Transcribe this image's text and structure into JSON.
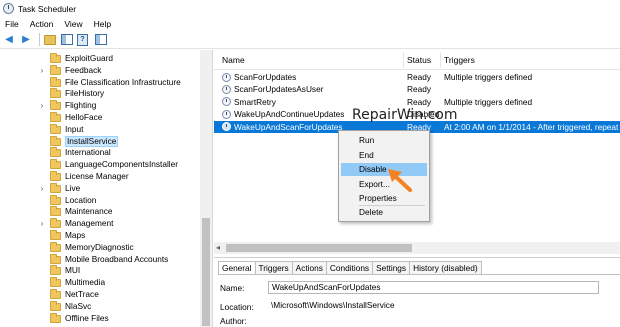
{
  "window": {
    "title": "Task Scheduler"
  },
  "menubar": [
    "File",
    "Action",
    "View",
    "Help"
  ],
  "tree": {
    "items": [
      {
        "label": "ExploitGuard",
        "expandable": false
      },
      {
        "label": "Feedback",
        "expandable": true
      },
      {
        "label": "File Classification Infrastructure",
        "expandable": false
      },
      {
        "label": "FileHistory",
        "expandable": false
      },
      {
        "label": "Flighting",
        "expandable": true
      },
      {
        "label": "HelloFace",
        "expandable": false
      },
      {
        "label": "Input",
        "expandable": false
      },
      {
        "label": "InstallService",
        "expandable": false,
        "selected": true
      },
      {
        "label": "International",
        "expandable": false
      },
      {
        "label": "LanguageComponentsInstaller",
        "expandable": false
      },
      {
        "label": "License Manager",
        "expandable": false
      },
      {
        "label": "Live",
        "expandable": true
      },
      {
        "label": "Location",
        "expandable": false
      },
      {
        "label": "Maintenance",
        "expandable": false
      },
      {
        "label": "Management",
        "expandable": true
      },
      {
        "label": "Maps",
        "expandable": false
      },
      {
        "label": "MemoryDiagnostic",
        "expandable": false
      },
      {
        "label": "Mobile Broadband Accounts",
        "expandable": false
      },
      {
        "label": "MUI",
        "expandable": false
      },
      {
        "label": "Multimedia",
        "expandable": false
      },
      {
        "label": "NetTrace",
        "expandable": false
      },
      {
        "label": "NlaSvc",
        "expandable": false
      },
      {
        "label": "Offline Files",
        "expandable": false
      }
    ]
  },
  "tasks": {
    "columns": [
      "Name",
      "Status",
      "Triggers"
    ],
    "rows": [
      {
        "name": "ScanForUpdates",
        "status": "Ready",
        "triggers": "Multiple triggers defined"
      },
      {
        "name": "ScanForUpdatesAsUser",
        "status": "Ready",
        "triggers": ""
      },
      {
        "name": "SmartRetry",
        "status": "Ready",
        "triggers": "Multiple triggers defined"
      },
      {
        "name": "WakeUpAndContinueUpdates",
        "status": "Disabled",
        "triggers": ""
      },
      {
        "name": "WakeUpAndScanForUpdates",
        "status": "Ready",
        "triggers": "At 2:00 AM on 1/1/2014 - After triggered, repeat ev",
        "selected": true
      }
    ]
  },
  "context_menu": {
    "items": [
      "Run",
      "End",
      "Disable",
      "Export...",
      "Properties",
      "Delete"
    ],
    "hovered": "Disable"
  },
  "watermark": "RepairWin.com",
  "detail": {
    "tabs": [
      "General",
      "Triggers",
      "Actions",
      "Conditions",
      "Settings",
      "History (disabled)"
    ],
    "active_tab": "General",
    "name_label": "Name:",
    "name_value": "WakeUpAndScanForUpdates",
    "location_label": "Location:",
    "location_value": "\\Microsoft\\Windows\\InstallService",
    "author_label": "Author:"
  },
  "colors": {
    "selection": "#0a78d7",
    "menu_hover": "#91c9f7",
    "annotation_arrow": "#f58220"
  }
}
